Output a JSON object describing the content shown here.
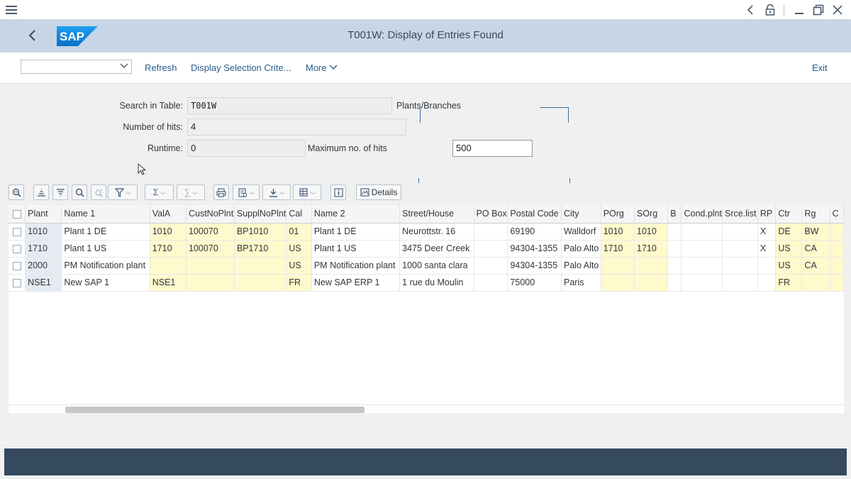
{
  "window": {
    "menu_icon": "hamburger-menu-icon",
    "controls": [
      "back-chevron-icon",
      "security-lock-icon",
      "minimize-icon",
      "restore-icon",
      "close-icon"
    ]
  },
  "shell": {
    "title": "T001W: Display of Entries Found",
    "logo_text": "SAP",
    "colors": {
      "header_bg": "#c7d6e6",
      "logo_blue": "#0a7ad4",
      "status_bar": "#354a5f"
    }
  },
  "toolbar": {
    "variant_value": "",
    "refresh": "Refresh",
    "display_selection": "Display Selection Crite...",
    "more": "More",
    "exit": "Exit"
  },
  "form": {
    "search_table_label": "Search in Table:",
    "search_table_value": "T001W",
    "table_description": "Plants/Branches",
    "hits_label": "Number of hits:",
    "hits_value": "4",
    "runtime_label": "Runtime:",
    "runtime_value": "0",
    "max_hits_label": "Maximum no. of hits",
    "max_hits_value": "500"
  },
  "alv_toolbar": {
    "details_label": "Details",
    "icons": [
      "zoom-icon",
      "sort-ascending-icon",
      "sort-descending-icon",
      "find-icon",
      "find-next-icon",
      "filter-icon",
      "sum-icon",
      "subtotal-icon",
      "print-icon",
      "view-icon",
      "export-icon",
      "layout-icon",
      "info-icon",
      "details-icon"
    ]
  },
  "table": {
    "columns": [
      "Plant",
      "Name 1",
      "ValA",
      "CustNoPlnt",
      "SupplNoPlnt",
      "Cal",
      "Name 2",
      "Street/House",
      "PO Box",
      "Postal Code",
      "City",
      "POrg",
      "SOrg",
      "B",
      "Cond.plnt",
      "Srce.list",
      "RP",
      "Ctr",
      "Rg",
      "C"
    ],
    "rows": [
      [
        "1010",
        "Plant 1 DE",
        "1010",
        "100070",
        "BP1010",
        "01",
        "Plant 1 DE",
        "Neurottstr. 16",
        "",
        "69190",
        "Walldorf",
        "1010",
        "1010",
        "",
        "",
        "",
        "X",
        "DE",
        "BW",
        ""
      ],
      [
        "1710",
        "Plant 1 US",
        "1710",
        "100070",
        "BP1710",
        "US",
        "Plant 1 US",
        "3475 Deer Creek",
        "",
        "94304-1355",
        "Palo Alto",
        "1710",
        "1710",
        "",
        "",
        "",
        "X",
        "US",
        "CA",
        ""
      ],
      [
        "2000",
        "PM Notification plant",
        "",
        "",
        "",
        "US",
        "PM Notification plant",
        "1000 santa clara",
        "",
        "94304-1355",
        "Palo Alto",
        "",
        "",
        "",
        "",
        "",
        "",
        "US",
        "CA",
        ""
      ],
      [
        "NSE1",
        "New SAP 1",
        "NSE1",
        "",
        "",
        "FR",
        "New SAP ERP 1",
        "1 rue du Moulin",
        "",
        "75000",
        "Paris",
        "",
        "",
        "",
        "",
        "",
        "",
        "FR",
        "",
        ""
      ]
    ]
  }
}
